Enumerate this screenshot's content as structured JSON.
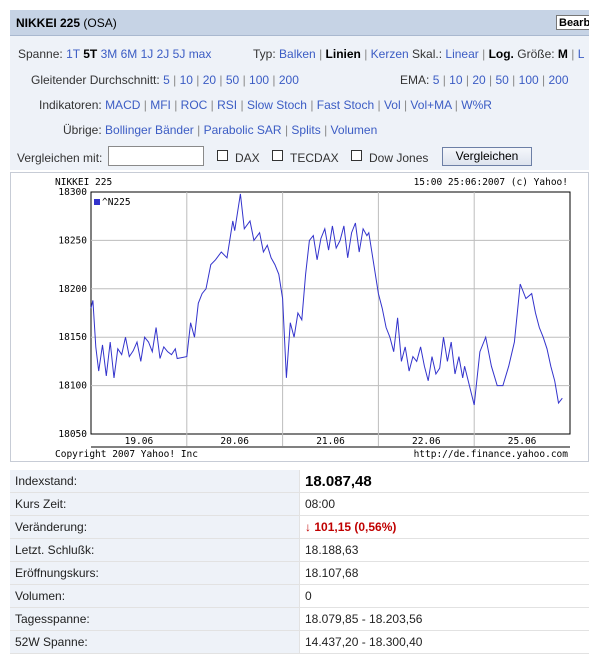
{
  "header": {
    "title_bold": "NIKKEI 225",
    "title_suffix": "(OSA)",
    "edit_label": "Bearbeiten"
  },
  "controls": {
    "spanne": {
      "label": "Spanne:",
      "options": [
        "1T",
        "5T",
        "3M",
        "6M",
        "1J",
        "2J",
        "5J",
        "max"
      ],
      "selected": "5T"
    },
    "typ": {
      "label": "Typ:",
      "options": [
        "Balken",
        "Linien",
        "Kerzen"
      ],
      "selected": "Linien"
    },
    "skal": {
      "label": "Skal.:",
      "options": [
        "Linear",
        "Log."
      ],
      "selected": "Log."
    },
    "groesse": {
      "label": "Größe:",
      "selected": "M",
      "next": "L"
    },
    "gd": {
      "label": "Gleitender Durchschnitt:",
      "options": [
        "5",
        "10",
        "20",
        "50",
        "100",
        "200"
      ]
    },
    "ema": {
      "label": "EMA:",
      "options": [
        "5",
        "10",
        "20",
        "50",
        "100",
        "200"
      ]
    },
    "indikatoren": {
      "label": "Indikatoren:",
      "options": [
        "MACD",
        "MFI",
        "ROC",
        "RSI",
        "Slow Stoch",
        "Fast Stoch",
        "Vol",
        "Vol+MA",
        "W%R"
      ]
    },
    "uebrige": {
      "label": "Übrige:",
      "options": [
        "Bollinger Bänder",
        "Parabolic SAR",
        "Splits",
        "Volumen"
      ]
    },
    "compare": {
      "label": "Vergleichen mit:",
      "input_value": "",
      "checkboxes": [
        "DAX",
        "TECDAX",
        "Dow Jones"
      ],
      "button": "Vergleichen"
    }
  },
  "chart_data": {
    "type": "line",
    "title": "NIKKEI 225",
    "header_right": "15:00 25:06:2007 (c) Yahoo!",
    "footer_left": "Copyright 2007 Yahoo! Inc",
    "footer_right": "http://de.finance.yahoo.com",
    "legend": "^N225",
    "categories": [
      "19.06",
      "20.06",
      "21.06",
      "22.06",
      "25.06"
    ],
    "ylim": [
      18050,
      18300
    ],
    "yticks": [
      18050,
      18100,
      18150,
      18200,
      18250,
      18300
    ],
    "series": [
      {
        "name": "^N225",
        "color": "#3333cc",
        "x": [
          0,
          0.02,
          0.05,
          0.08,
          0.12,
          0.16,
          0.2,
          0.24,
          0.28,
          0.32,
          0.36,
          0.4,
          0.44,
          0.48,
          0.52,
          0.56,
          0.6,
          0.64,
          0.68,
          0.72,
          0.76,
          0.8,
          0.84,
          0.88,
          0.9,
          1.0,
          1.04,
          1.08,
          1.12,
          1.16,
          1.2,
          1.25,
          1.3,
          1.36,
          1.42,
          1.48,
          1.5,
          1.56,
          1.6,
          1.66,
          1.7,
          1.76,
          1.8,
          1.84,
          1.88,
          1.92,
          1.96,
          2.0,
          2.04,
          2.08,
          2.12,
          2.16,
          2.2,
          2.24,
          2.28,
          2.32,
          2.36,
          2.4,
          2.44,
          2.48,
          2.52,
          2.56,
          2.6,
          2.64,
          2.68,
          2.72,
          2.76,
          2.8,
          2.84,
          2.88,
          2.9,
          3.0,
          3.04,
          3.08,
          3.12,
          3.16,
          3.2,
          3.24,
          3.28,
          3.32,
          3.36,
          3.4,
          3.44,
          3.48,
          3.52,
          3.56,
          3.6,
          3.64,
          3.68,
          3.72,
          3.76,
          3.8,
          3.84,
          3.88,
          3.9,
          4.0,
          4.06,
          4.12,
          4.18,
          4.24,
          4.3,
          4.36,
          4.42,
          4.48,
          4.54,
          4.6,
          4.64,
          4.68,
          4.72,
          4.76,
          4.8,
          4.84,
          4.88,
          4.92
        ],
        "values": [
          18180,
          18188,
          18140,
          18115,
          18142,
          18110,
          18145,
          18108,
          18138,
          18132,
          18150,
          18130,
          18136,
          18145,
          18125,
          18150,
          18145,
          18135,
          18160,
          18128,
          18140,
          18135,
          18132,
          18138,
          18128,
          18130,
          18165,
          18150,
          18185,
          18195,
          18200,
          18225,
          18230,
          18238,
          18232,
          18270,
          18260,
          18298,
          18262,
          18270,
          18250,
          18258,
          18238,
          18245,
          18232,
          18225,
          18215,
          18190,
          18108,
          18165,
          18150,
          18175,
          18168,
          18215,
          18250,
          18255,
          18230,
          18252,
          18262,
          18240,
          18265,
          18242,
          18250,
          18265,
          18232,
          18258,
          18268,
          18238,
          18262,
          18255,
          18258,
          18195,
          18180,
          18160,
          18150,
          18135,
          18170,
          18125,
          18140,
          18115,
          18130,
          18125,
          18140,
          18120,
          18105,
          18130,
          18112,
          18118,
          18150,
          18125,
          18145,
          18112,
          18130,
          18108,
          18120,
          18080,
          18135,
          18150,
          18120,
          18100,
          18100,
          18120,
          18145,
          18205,
          18190,
          18195,
          18175,
          18160,
          18150,
          18138,
          18120,
          18105,
          18082,
          18087
        ]
      }
    ]
  },
  "stats": [
    {
      "label": "Indexstand:",
      "value": "18.087,48",
      "style": "big"
    },
    {
      "label": "Kurs Zeit:",
      "value": "08:00",
      "style": ""
    },
    {
      "label": "Veränderung:",
      "value": "101,15 (0,56%)",
      "style": "red",
      "arrow": "down-arrow-icon"
    },
    {
      "label": "Letzt. Schlußk:",
      "value": "18.188,63",
      "style": ""
    },
    {
      "label": "Eröffnungskurs:",
      "value": "18.107,68",
      "style": ""
    },
    {
      "label": "Volumen:",
      "value": "0",
      "style": ""
    },
    {
      "label": "Tagesspanne:",
      "value": "18.079,85 - 18.203,56",
      "style": ""
    },
    {
      "label": "52W Spanne:",
      "value": "14.437,20 - 18.300,40",
      "style": ""
    }
  ]
}
